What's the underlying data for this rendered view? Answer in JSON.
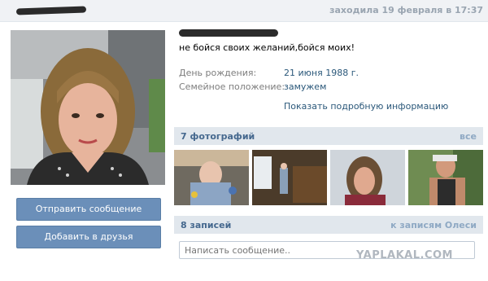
{
  "header": {
    "last_seen": "заходила 19 февраля в 17:37"
  },
  "profile": {
    "status": "не бойся своих желаний,бойся моих!",
    "info": [
      {
        "label": "День рождения:",
        "value": "21 июня 1988 г."
      },
      {
        "label": "Семейное положение:",
        "value": "замужем"
      }
    ],
    "details_link": "Показать подробную информацию"
  },
  "actions": {
    "send_message": "Отправить сообщение",
    "add_friend": "Добавить в друзья"
  },
  "photos": {
    "title": "7 фотографий",
    "all_link": "все",
    "thumbnails": [
      "baby-photo",
      "room-photo",
      "woman-photo",
      "man-photo"
    ]
  },
  "wall": {
    "title": "8 записей",
    "link": "к записям Олеси",
    "compose_placeholder": "Написать сообщение.."
  },
  "watermark": "YAPLAKAL.COM",
  "colors": {
    "button_bg": "#6b8fb9",
    "header_bg": "#e1e7ed",
    "link": "#2b587a",
    "label": "#7d7d7d"
  }
}
